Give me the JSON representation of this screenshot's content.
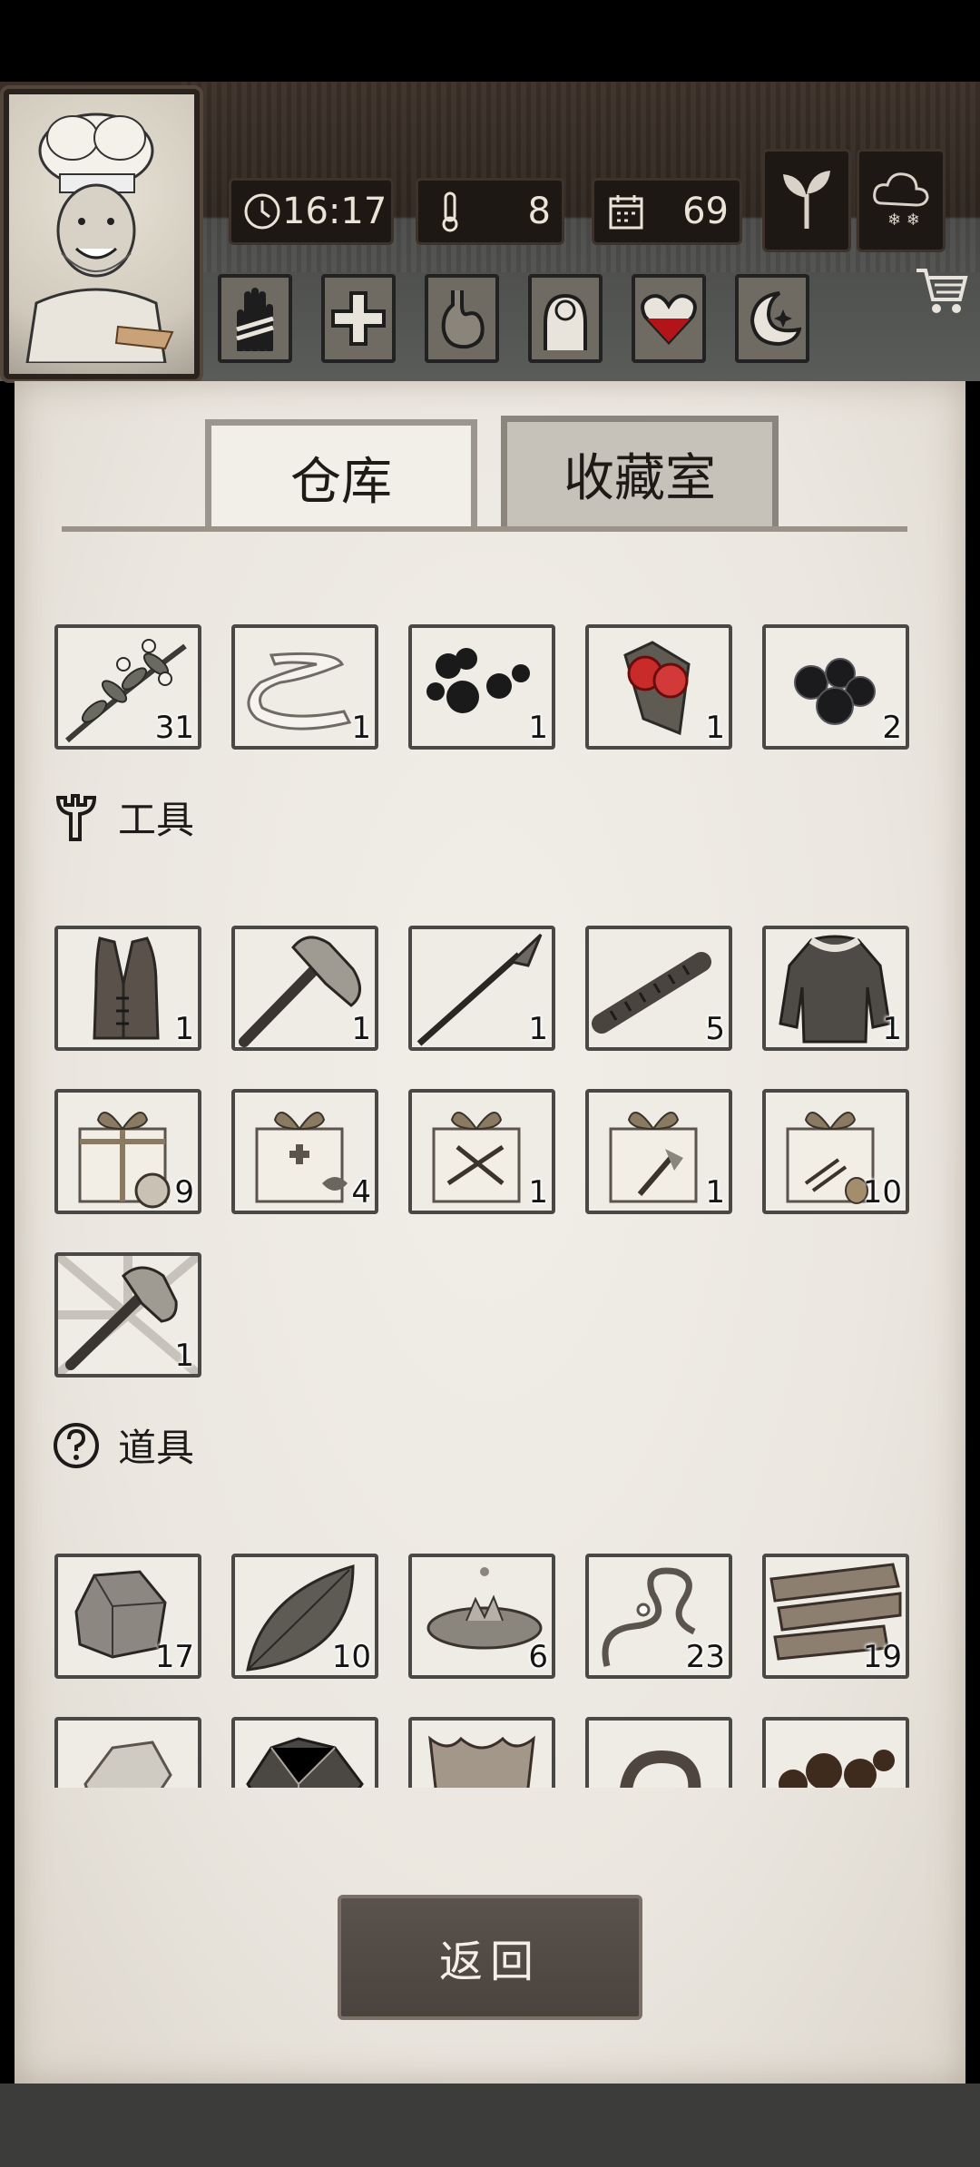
{
  "hud": {
    "time": "16:17",
    "temperature": "8",
    "day": "69",
    "icons": [
      "clock-icon",
      "thermometer-icon",
      "calendar-icon",
      "sprout-icon",
      "weather-snow-cloud-icon",
      "shopping-cart-icon"
    ],
    "status_icons": [
      "bandaged-hand-icon",
      "medical-cross-icon",
      "stomach-icon",
      "head-sanity-icon",
      "heart-health-icon",
      "moon-sleep-icon"
    ]
  },
  "tabs": {
    "warehouse": "仓库",
    "collection": "收藏室"
  },
  "materials": [
    {
      "icon": "herb-branch-icon",
      "count": "31"
    },
    {
      "icon": "cloth-strip-icon",
      "count": "1"
    },
    {
      "icon": "black-beads-icon",
      "count": "1"
    },
    {
      "icon": "red-berries-icon",
      "count": "1"
    },
    {
      "icon": "dark-berries-icon",
      "count": "2"
    }
  ],
  "sections": {
    "tools": "工具",
    "props": "道具"
  },
  "tools": [
    {
      "icon": "leather-vest-icon",
      "count": "1"
    },
    {
      "icon": "stone-axe-icon",
      "count": "1"
    },
    {
      "icon": "spear-icon",
      "count": "1"
    },
    {
      "icon": "wooden-club-icon",
      "count": "5"
    },
    {
      "icon": "fur-coat-icon",
      "count": "1"
    },
    {
      "icon": "food-gift-box-icon",
      "count": "9"
    },
    {
      "icon": "medical-gift-box-icon",
      "count": "4"
    },
    {
      "icon": "weapon-gift-box-icon",
      "count": "1"
    },
    {
      "icon": "tool-gift-box-icon",
      "count": "1"
    },
    {
      "icon": "material-gift-box-icon",
      "count": "10"
    },
    {
      "icon": "special-axe-icon",
      "count": "1"
    }
  ],
  "props": [
    {
      "icon": "stone-icon",
      "count": "17"
    },
    {
      "icon": "leaf-icon",
      "count": "10"
    },
    {
      "icon": "water-puddle-icon",
      "count": "6"
    },
    {
      "icon": "vine-icon",
      "count": "23"
    },
    {
      "icon": "wood-planks-icon",
      "count": "19"
    },
    {
      "icon": "white-stone-icon",
      "count": ""
    },
    {
      "icon": "ore-icon",
      "count": ""
    },
    {
      "icon": "hide-icon",
      "count": ""
    },
    {
      "icon": "rope-icon",
      "count": ""
    },
    {
      "icon": "mud-icon",
      "count": ""
    }
  ],
  "back_label": "返回"
}
